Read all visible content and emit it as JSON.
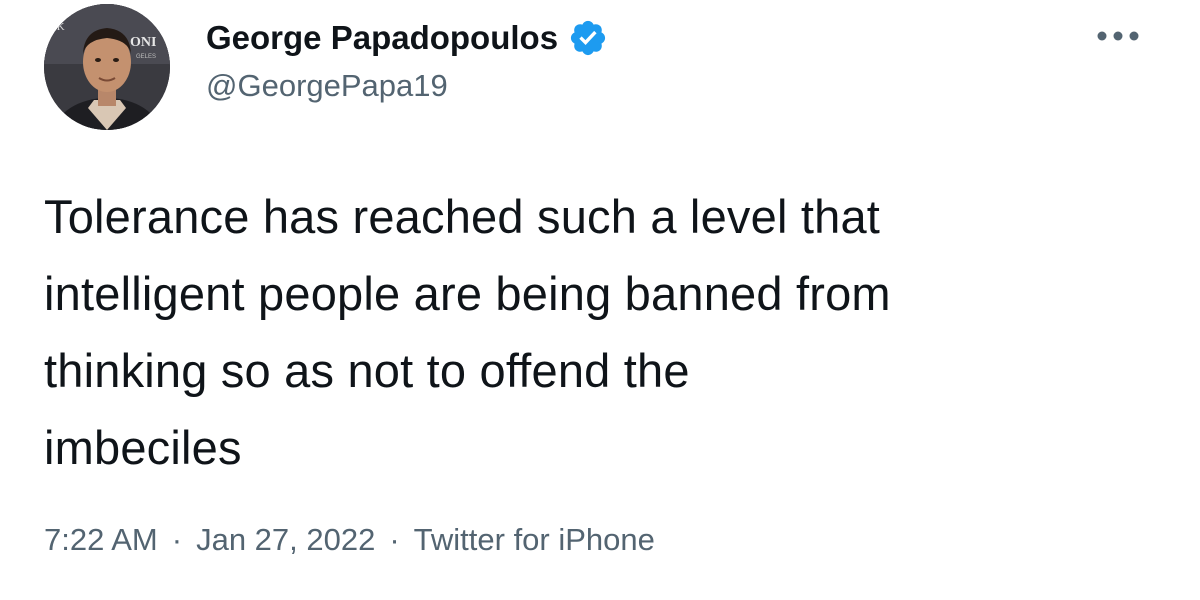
{
  "author": {
    "display_name": "George Papadopoulos",
    "handle": "@GeorgePapa19",
    "verified": true,
    "avatar_label": "profile photo",
    "avatar_backdrop_text_left": "EK",
    "avatar_backdrop_text_right": "ONI",
    "avatar_backdrop_text_small": "GELES"
  },
  "tweet": {
    "text": "Tolerance has reached such a level that\nintelligent people are being banned from\nthinking so as not to offend the\nimbeciles"
  },
  "meta": {
    "time": "7:22 AM",
    "separator": "·",
    "date": "Jan 27, 2022",
    "source": "Twitter for iPhone"
  },
  "icons": {
    "verified": "verified-badge-icon",
    "more": "more-options-icon"
  },
  "colors": {
    "text_primary": "#0f1419",
    "text_secondary": "#536471",
    "verified_blue": "#1d9bf0"
  }
}
